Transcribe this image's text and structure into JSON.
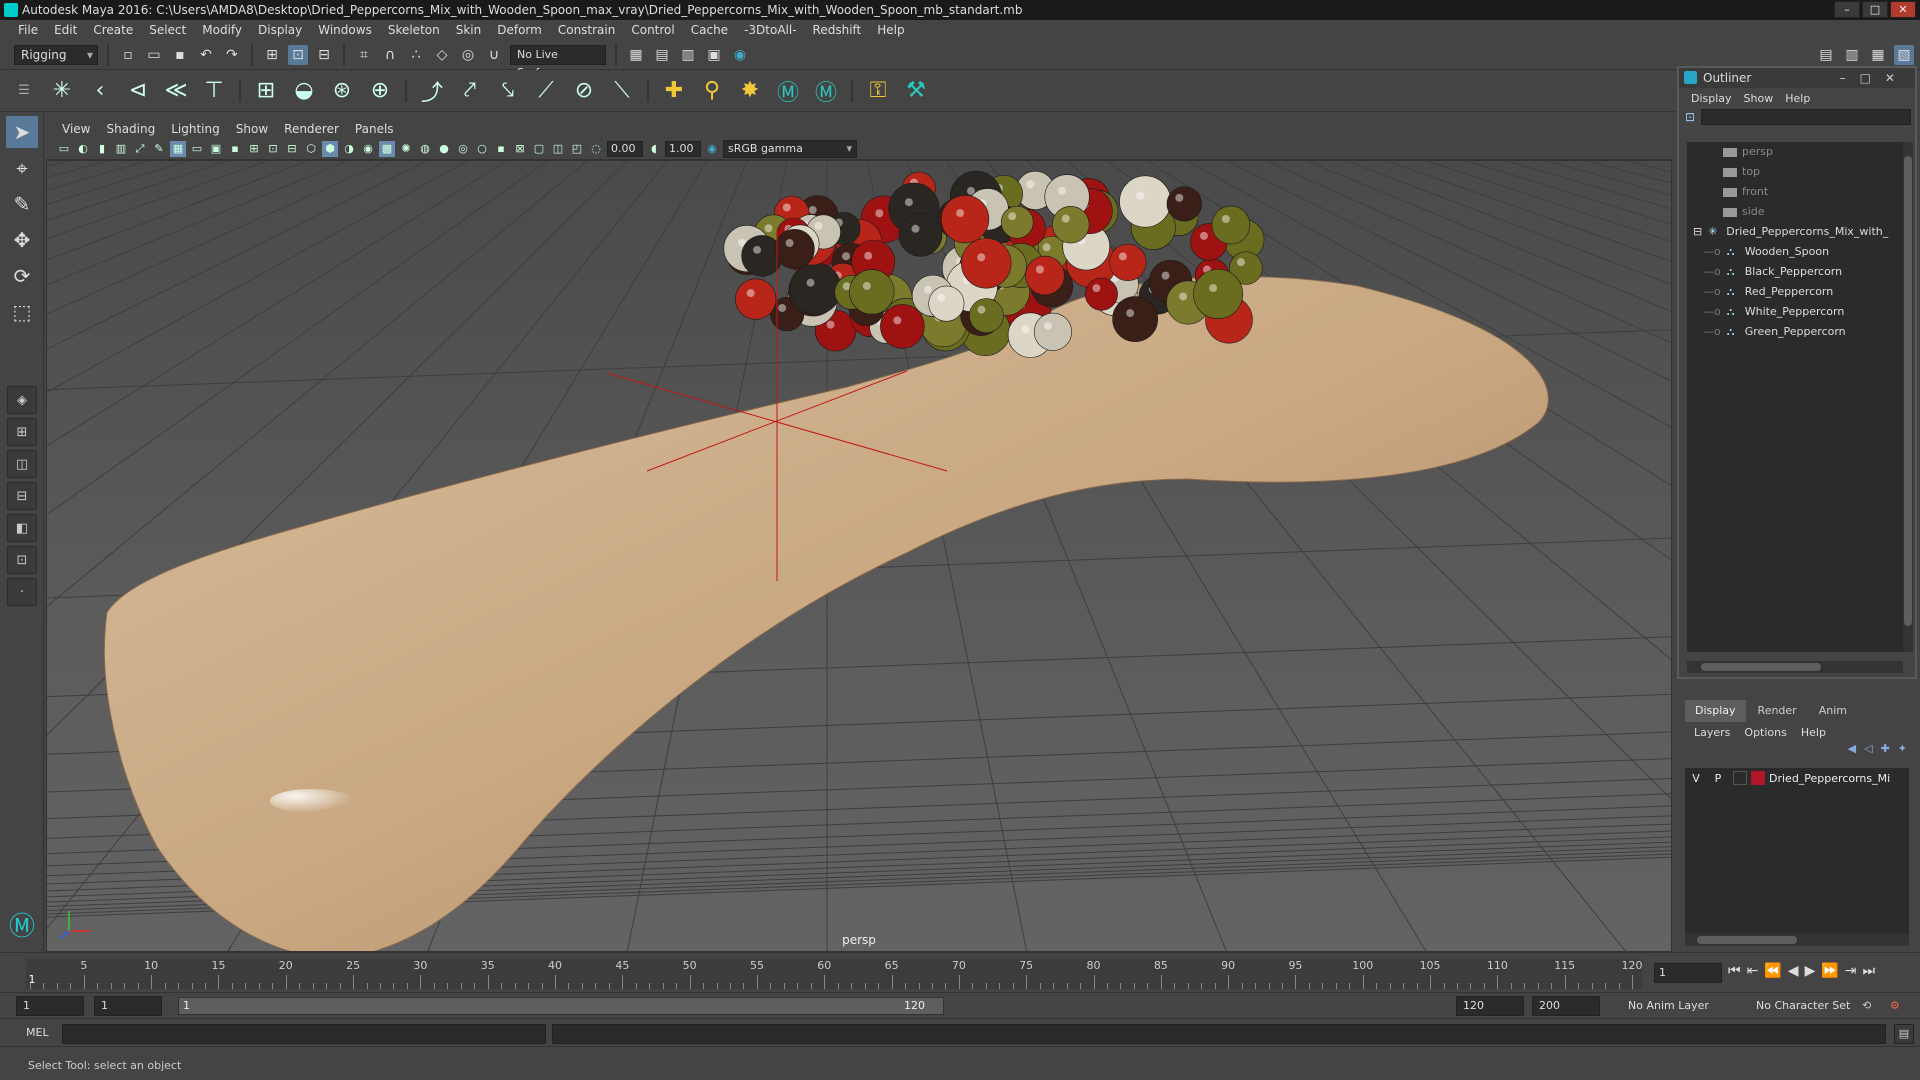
{
  "window": {
    "title": "Autodesk Maya 2016: C:\\Users\\AMDA8\\Desktop\\Dried_Peppercorns_Mix_with_Wooden_Spoon_max_vray\\Dried_Peppercorns_Mix_with_Wooden_Spoon_mb_standart.mb",
    "controls": [
      "–",
      "□",
      "✕"
    ]
  },
  "menubar": [
    "File",
    "Edit",
    "Create",
    "Select",
    "Modify",
    "Display",
    "Windows",
    "Skeleton",
    "Skin",
    "Deform",
    "Constrain",
    "Control",
    "Cache",
    "-3DtoAll-",
    "Redshift",
    "Help"
  ],
  "statusline": {
    "menuset": "Rigging",
    "live_surface": "No Live Surface"
  },
  "viewport": {
    "menu": [
      "View",
      "Shading",
      "Lighting",
      "Show",
      "Renderer",
      "Panels"
    ],
    "exposure": "0.00",
    "gamma": "1.00",
    "color_space": "sRGB gamma",
    "camera": "persp"
  },
  "outliner": {
    "title": "Outliner",
    "menu": [
      "Display",
      "Show",
      "Help"
    ],
    "items": [
      {
        "label": "persp",
        "type": "camera",
        "level": 0
      },
      {
        "label": "top",
        "type": "camera",
        "level": 0
      },
      {
        "label": "front",
        "type": "camera",
        "level": 0
      },
      {
        "label": "side",
        "type": "camera",
        "level": 0
      },
      {
        "label": "Dried_Peppercorns_Mix_with_",
        "type": "group",
        "level": 0
      },
      {
        "label": "Wooden_Spoon",
        "type": "mesh",
        "level": 1
      },
      {
        "label": "Black_Peppercorn",
        "type": "mesh",
        "level": 1
      },
      {
        "label": "Red_Peppercorn",
        "type": "mesh",
        "level": 1
      },
      {
        "label": "White_Peppercorn",
        "type": "mesh",
        "level": 1
      },
      {
        "label": "Green_Peppercorn",
        "type": "mesh",
        "level": 1
      }
    ]
  },
  "layers": {
    "tabs": [
      "Display",
      "Render",
      "Anim"
    ],
    "active_tab": "Display",
    "menu": [
      "Layers",
      "Options",
      "Help"
    ],
    "rows": [
      {
        "v": "V",
        "p": "P",
        "color": "#b0182a",
        "name": "Dried_Peppercorns_Mi"
      }
    ]
  },
  "timeline": {
    "ticks": [
      "5",
      "10",
      "15",
      "20",
      "25",
      "30",
      "35",
      "40",
      "45",
      "50",
      "55",
      "60",
      "65",
      "70",
      "75",
      "80",
      "85",
      "90",
      "95",
      "100",
      "105",
      "110",
      "115",
      "120"
    ],
    "current_marker": "1",
    "current_frame": "1"
  },
  "range": {
    "start": "1",
    "anim_start": "1",
    "slider_start": "1",
    "slider_end": "120",
    "end": "120",
    "anim_end": "200",
    "anim_layer": "No Anim Layer",
    "character_set": "No Character Set"
  },
  "cmdline": {
    "label": "MEL"
  },
  "help": "Select Tool: select an object"
}
